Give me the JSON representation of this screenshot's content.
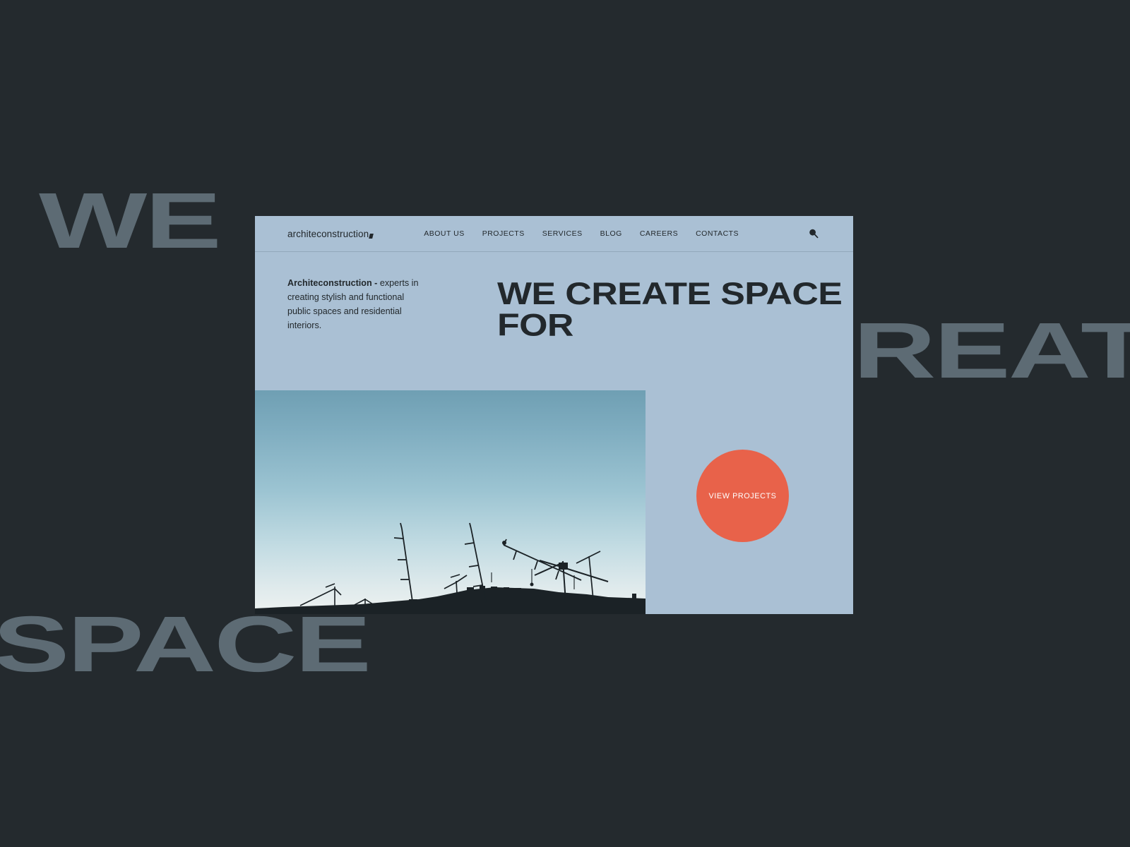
{
  "background_type": {
    "line1": "WE",
    "line2": "REAT",
    "line3": "SPACE",
    "color": "#5d6b74"
  },
  "page_background_color": "#242a2e",
  "window": {
    "background_color": "#aac0d4",
    "header": {
      "logo": "architeconstruction",
      "nav": [
        {
          "label": "ABOUT US"
        },
        {
          "label": "PROJECTS"
        },
        {
          "label": "SERVICES"
        },
        {
          "label": "BLOG"
        },
        {
          "label": "CAREERS"
        },
        {
          "label": "CONTACTS"
        }
      ],
      "search_icon": "search-icon"
    },
    "hero": {
      "intro_lead": "Architeconstruction -",
      "intro_body": "experts in creating stylish and functional public spaces and residential interiors.",
      "headline": "WE CREATE SPACE\nFOR"
    },
    "lower": {
      "photo_alt": "construction cranes silhouette",
      "cta_label": "VIEW PROJECTS",
      "cta_color": "#e8624a"
    }
  }
}
